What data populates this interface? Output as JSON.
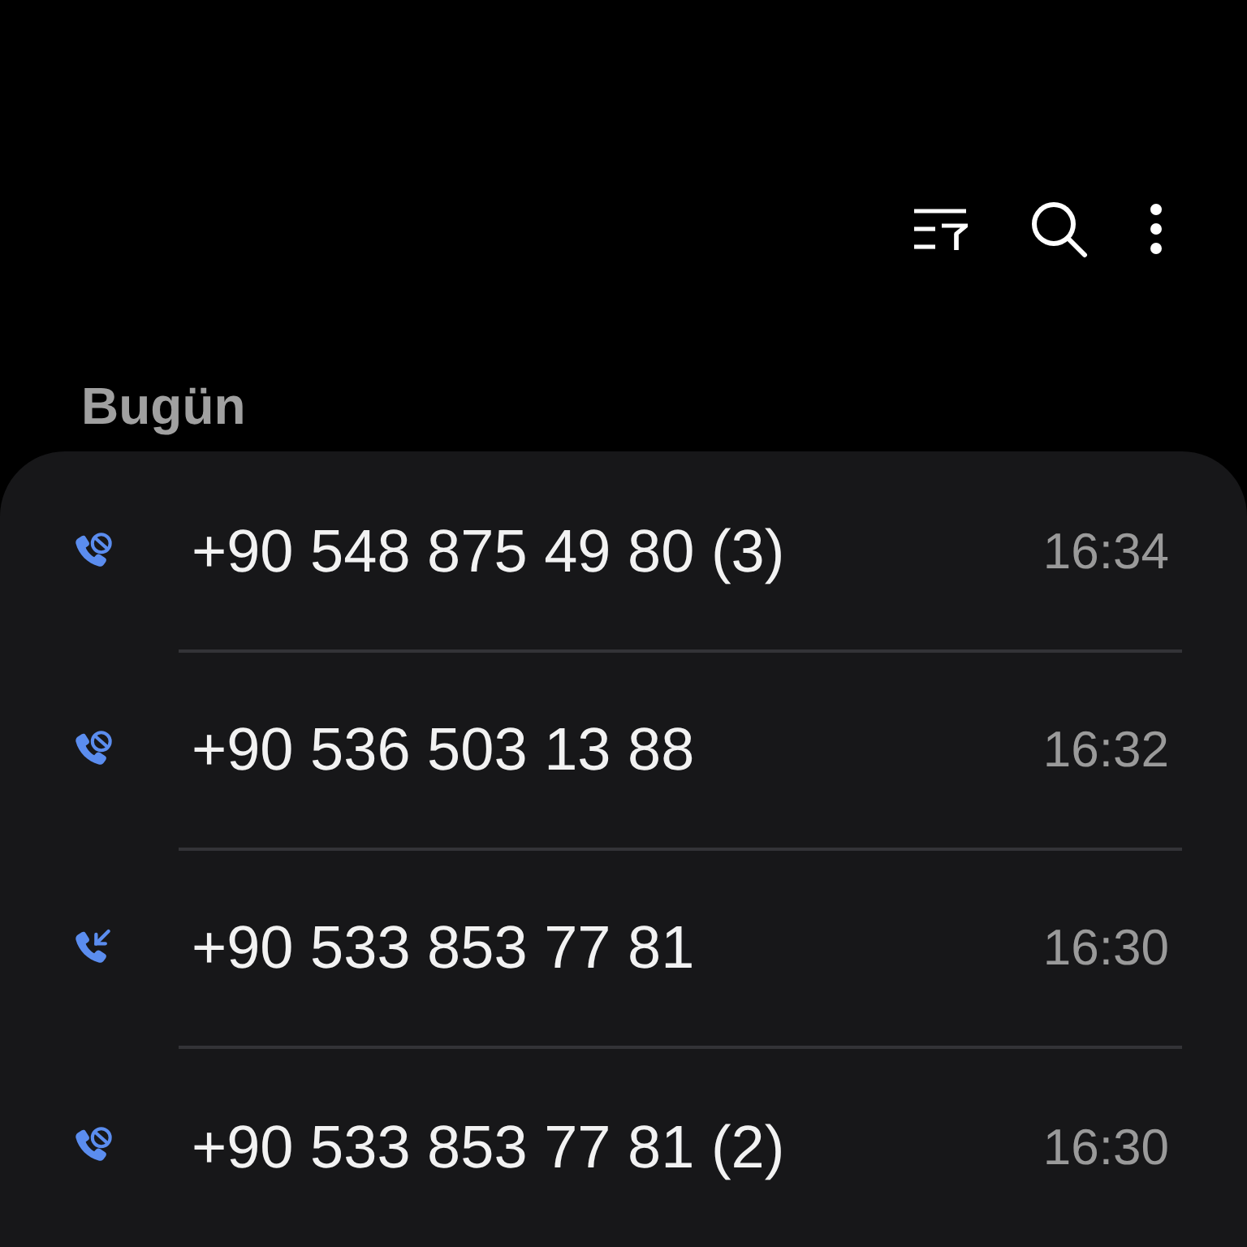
{
  "section": {
    "title": "Bugün"
  },
  "calls": [
    {
      "kind": "blocked",
      "number": "+90 548 875 49 80 (3)",
      "time": "16:34"
    },
    {
      "kind": "blocked",
      "number": "+90 536 503 13 88",
      "time": "16:32"
    },
    {
      "kind": "incoming",
      "number": "+90 533 853 77 81",
      "time": "16:30"
    },
    {
      "kind": "blocked",
      "number": "+90 533 853 77 81 (2)",
      "time": "16:30"
    }
  ]
}
